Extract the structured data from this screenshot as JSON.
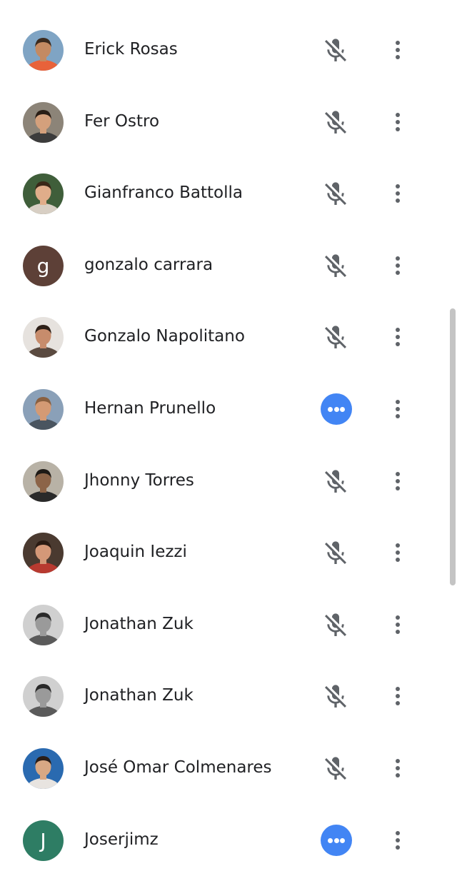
{
  "participants": [
    {
      "name": "Erick Rosas",
      "avatar": "photo",
      "status": "muted",
      "colors": {
        "bg": "#7fa4c4",
        "skin": "#c48a62",
        "hair": "#3b2a1e",
        "shirt": "#e8623a"
      }
    },
    {
      "name": "Fer Ostro",
      "avatar": "photo",
      "status": "muted",
      "colors": {
        "bg": "#8c8478",
        "skin": "#d4a07c",
        "hair": "#2a1e16",
        "shirt": "#3c3c3c"
      }
    },
    {
      "name": "Gianfranco Battolla",
      "avatar": "photo",
      "status": "muted",
      "colors": {
        "bg": "#3f5e3a",
        "skin": "#e0ad8a",
        "hair": "#3a2818",
        "shirt": "#d8cfc4"
      }
    },
    {
      "name": "gonzalo carrara",
      "avatar": "letter",
      "letter": "g",
      "status": "muted",
      "colors": {
        "bg": "#5d4037"
      }
    },
    {
      "name": "Gonzalo Napolitano",
      "avatar": "photo",
      "status": "muted",
      "colors": {
        "bg": "#e6e2de",
        "skin": "#c78c6c",
        "hair": "#2e2018",
        "shirt": "#5a4a40"
      }
    },
    {
      "name": "Hernan Prunello",
      "avatar": "photo",
      "status": "speaking",
      "colors": {
        "bg": "#8aa0b8",
        "skin": "#d49a74",
        "hair": "#8a6040",
        "shirt": "#4a5560"
      }
    },
    {
      "name": "Jhonny Torres",
      "avatar": "photo",
      "status": "muted",
      "colors": {
        "bg": "#b8b2a6",
        "skin": "#8c6448",
        "hair": "#1e1a16",
        "shirt": "#2a2a2a"
      }
    },
    {
      "name": "Joaquin Iezzi",
      "avatar": "photo",
      "status": "muted",
      "colors": {
        "bg": "#4a3a30",
        "skin": "#d49878",
        "hair": "#2a1a12",
        "shirt": "#b83a30"
      }
    },
    {
      "name": "Jonathan Zuk",
      "avatar": "photo",
      "status": "muted",
      "colors": {
        "bg": "#d0d0d0",
        "skin": "#9a9a9a",
        "hair": "#2a2a2a",
        "shirt": "#5a5a5a"
      }
    },
    {
      "name": "Jonathan Zuk",
      "avatar": "photo",
      "status": "muted",
      "colors": {
        "bg": "#d0d0d0",
        "skin": "#9a9a9a",
        "hair": "#2a2a2a",
        "shirt": "#5a5a5a"
      }
    },
    {
      "name": "José Omar Colmenares",
      "avatar": "photo",
      "status": "muted",
      "colors": {
        "bg": "#2a6ab0",
        "skin": "#d8a884",
        "hair": "#2a1e18",
        "shirt": "#e8e4e0"
      }
    },
    {
      "name": "Joserjimz",
      "avatar": "letter",
      "letter": "J",
      "status": "speaking",
      "colors": {
        "bg": "#2e7d64"
      }
    }
  ],
  "icons": {
    "muted": "mic-off-icon",
    "speaking": "speaking-indicator-icon",
    "more": "more-vert-icon"
  },
  "theme": {
    "speaking_color": "#4285f4",
    "icon_color": "#5f6368",
    "scrollbar_color": "#c4c4c4"
  }
}
